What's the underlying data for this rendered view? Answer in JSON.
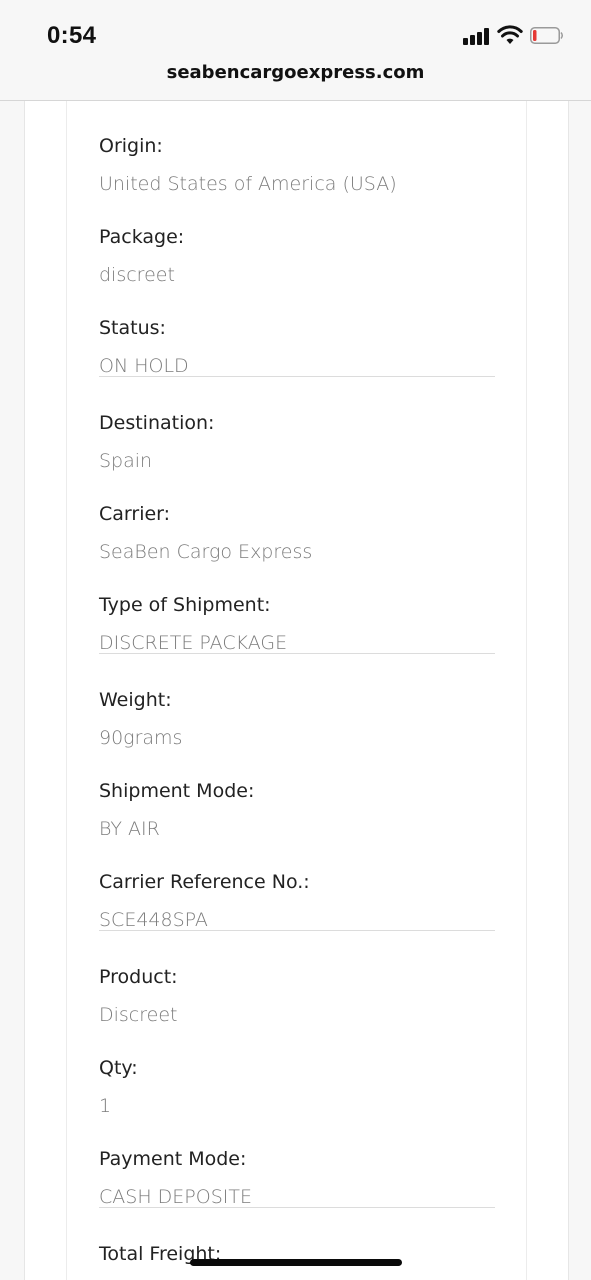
{
  "status_bar": {
    "time": "0:54",
    "icons": [
      "signal-icon",
      "wifi-icon",
      "battery-icon"
    ],
    "battery_color": "#e53935"
  },
  "browser": {
    "url": "seabencargoexpress.com"
  },
  "shipment": {
    "fields": [
      {
        "label": "Origin:",
        "value": "United States of America (USA)"
      },
      {
        "label": "Package:",
        "value": "discreet"
      },
      {
        "label": "Status:",
        "value": "ON HOLD"
      },
      {
        "label": "Destination:",
        "value": "Spain"
      },
      {
        "label": "Carrier:",
        "value": "SeaBen Cargo Express"
      },
      {
        "label": "Type of Shipment:",
        "value": "DISCRETE PACKAGE"
      },
      {
        "label": "Weight:",
        "value": "90grams"
      },
      {
        "label": "Shipment Mode:",
        "value": "BY AIR"
      },
      {
        "label": "Carrier Reference No.:",
        "value": "SCE448SPA"
      },
      {
        "label": "Product:",
        "value": "Discreet"
      },
      {
        "label": "Qty:",
        "value": "1"
      },
      {
        "label": "Payment Mode:",
        "value": "CASH DEPOSITE"
      },
      {
        "label": "Total Freight:",
        "value": ""
      }
    ]
  }
}
